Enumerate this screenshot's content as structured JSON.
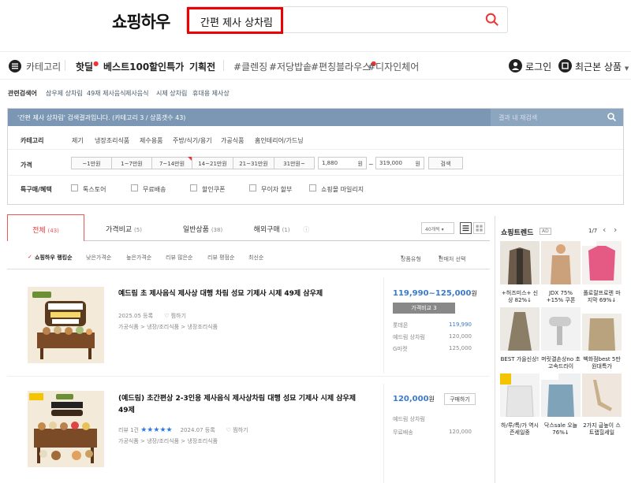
{
  "header": {
    "logo": "쇼핑하우",
    "search_value": "간편 제사 상차림"
  },
  "nav": {
    "category": "카테고리",
    "items": [
      "핫딜",
      "베스트100",
      "할인특가",
      "기획전"
    ],
    "tags": [
      "#클렌징",
      "#저당밥솥",
      "#편칭블라우스",
      "#디자인체어"
    ],
    "login": "로그인",
    "recent": "최근본 상품"
  },
  "related": {
    "label": "관련검색어",
    "items": [
      "삼우제 상차림",
      "49재 제사음식",
      "제사음식",
      "시제 상차림",
      "휴대용 제사상"
    ]
  },
  "filter": {
    "message": "'간편 제사 상차림' 검색결과입니다. (카테고리 3 / 상품갯수 43)",
    "in_result_placeholder": "결과 내 재검색",
    "category_label": "카테고리",
    "categories": [
      "제기",
      "냉장조리식품",
      "제수용품",
      "주방/식기/용기",
      "가공식품",
      "홈인테리어/가드닝"
    ],
    "price_label": "가격",
    "price_ranges": [
      "~1만원",
      "1~7만원",
      "7~14만원",
      "14~21만원",
      "21~31만원",
      "31만원~"
    ],
    "price_min": "1,880",
    "price_max": "319,000",
    "won": "원",
    "tilde": "~",
    "search_btn": "검색",
    "special_label": "특구매/혜택",
    "specials": [
      "톡스토어",
      "무료배송",
      "할인쿠폰",
      "무이자 할부",
      "쇼핑몰 마일리지"
    ]
  },
  "tabs": [
    {
      "label": "전체",
      "count": "(43)"
    },
    {
      "label": "가격비교",
      "count": "(5)"
    },
    {
      "label": "일반상품",
      "count": "(38)"
    },
    {
      "label": "해외구매",
      "count": "(1)"
    }
  ],
  "per_page": "40개씩",
  "sort": {
    "options": [
      "쇼핑하우 랭킹순",
      "낮은가격순",
      "높은가격순",
      "리뷰 많은순",
      "리뷰 평점순",
      "최신순"
    ],
    "type_label": "상품유형",
    "seller_label": "판매처 선택"
  },
  "products": [
    {
      "title": "예드림 초 제사음식 제사상 대행 차림 성묘 기제사 시제 49제 삼우제",
      "date": "2025.05 등록",
      "wish": "찜하기",
      "cats": "가공식품 > 냉장/조리식품 > 냉장조리식품",
      "price": "119,990~125,000",
      "won": "원",
      "compare": "가격비교 3",
      "malls": [
        {
          "name": "롯데몬",
          "price": "119,990"
        },
        {
          "name": "예드림 상차림",
          "price": "120,000"
        },
        {
          "name": "G마켓",
          "price": "125,000"
        }
      ]
    },
    {
      "title": "(예드림) 초간편상 2-3인용 제사음식 제사상차림 대행 성묘 기제사 시제 삼우제 49제",
      "review": "리뷰 1건",
      "stars": "★★★★★",
      "date": "2024.07 등록",
      "wish": "찜하기",
      "cats": "가공식품 > 냉장/조리식품 > 냉장조리식품",
      "price": "120,000",
      "won": "원",
      "buy": "구매하기",
      "malls": [
        {
          "name": "예드림 상차림",
          "price": ""
        },
        {
          "name": "무료배송",
          "price": "120,000"
        }
      ]
    }
  ],
  "trend": {
    "title": "쇼핑트렌드",
    "ad": "AD",
    "page": "1/7",
    "prev": "‹",
    "next": "›",
    "items": [
      "+허즈미스+ 신상 82%↓",
      "JDX 75% +15% 쿠폰",
      "폴로랄프로렌 마지막 69%↓",
      "BEST 가을신상!",
      "머릿결손상no 초고속드라이",
      "벡화점best 5만원대특가",
      "하/루/특/가 역시즌세일중",
      "닥스sale 오늘 76%↓",
      "2가지 굽높이 스트랩힐세일"
    ]
  }
}
